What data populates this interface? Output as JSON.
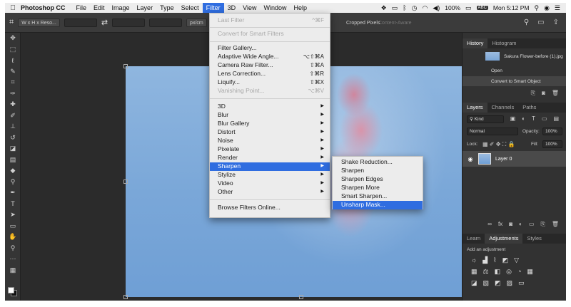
{
  "menubar": {
    "app": "Photoshop CC",
    "items": [
      "File",
      "Edit",
      "Image",
      "Layer",
      "Type",
      "Select",
      "Filter",
      "3D",
      "View",
      "Window",
      "Help"
    ],
    "battery": "100%",
    "input_source": "ABC",
    "clock": "Mon 5:12 PM"
  },
  "options": {
    "ratio": "W x H x Reso...",
    "unit": "px/cm",
    "cropped_pixels": "Cropped Pixels",
    "content_aware": "Content-Aware"
  },
  "filter_menu": {
    "last_filter": {
      "label": "Last Filter",
      "shortcut": "^⌘F"
    },
    "convert": "Convert for Smart Filters",
    "group2": [
      {
        "label": "Filter Gallery...",
        "shortcut": ""
      },
      {
        "label": "Adaptive Wide Angle...",
        "shortcut": "⌥⇧⌘A"
      },
      {
        "label": "Camera Raw Filter...",
        "shortcut": "⇧⌘A"
      },
      {
        "label": "Lens Correction...",
        "shortcut": "⇧⌘R"
      },
      {
        "label": "Liquify...",
        "shortcut": "⇧⌘X"
      },
      {
        "label": "Vanishing Point...",
        "shortcut": "⌥⌘V"
      }
    ],
    "group3": [
      "3D",
      "Blur",
      "Blur Gallery",
      "Distort",
      "Noise",
      "Pixelate",
      "Render",
      "Sharpen",
      "Stylize",
      "Video",
      "Other"
    ],
    "browse": "Browse Filters Online..."
  },
  "sharpen_menu": {
    "items": [
      "Shake Reduction...",
      "Sharpen",
      "Sharpen Edges",
      "Sharpen More",
      "Smart Sharpen...",
      "Unsharp Mask..."
    ]
  },
  "history": {
    "tabs": [
      "History",
      "Histogram"
    ],
    "snapshot": "Sakura Flower-before (1).jpg",
    "states": [
      "Open",
      "Convert to Smart Object"
    ]
  },
  "layers": {
    "tabs": [
      "Layers",
      "Channels",
      "Paths"
    ],
    "kind": "Kind",
    "blend": "Normal",
    "opacity_label": "Opacity:",
    "opacity": "100%",
    "lock_label": "Lock:",
    "fill_label": "Fill:",
    "fill": "100%",
    "layer_name": "Layer 0"
  },
  "adjustments": {
    "tabs": [
      "Learn",
      "Adjustments",
      "Styles"
    ],
    "heading": "Add an adjustment"
  },
  "colors": {
    "highlight": "#2f6de0"
  }
}
